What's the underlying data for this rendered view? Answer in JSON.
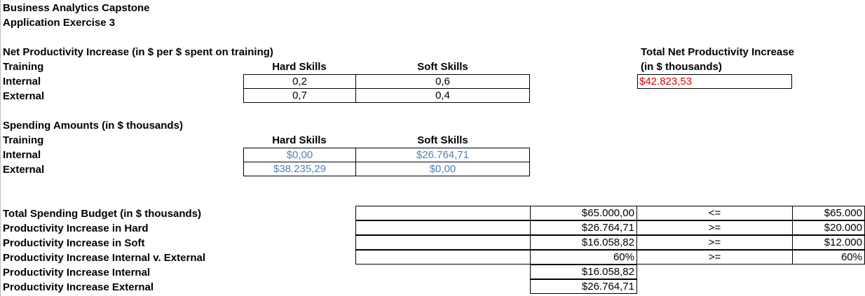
{
  "title": "Business Analytics Capstone",
  "subtitle": "Application Exercise 3",
  "net_productivity": {
    "heading": "Net Productivity Increase (in $ per $ spent on training)",
    "row_header": "Training",
    "col_hard": "Hard Skills",
    "col_soft": "Soft Skills",
    "rows": [
      {
        "label": "Internal",
        "hard": "0,2",
        "soft": "0,6"
      },
      {
        "label": "External",
        "hard": "0,7",
        "soft": "0,4"
      }
    ]
  },
  "total_net": {
    "heading1": "Total Net Productivity Increase",
    "heading2": "(in $ thousands)",
    "value": "$42.823,53",
    "value_color": "#e00000"
  },
  "spending": {
    "heading": "Spending Amounts (in $ thousands)",
    "row_header": "Training",
    "col_hard": "Hard Skills",
    "col_soft": "Soft Skills",
    "value_color": "#4f81bd",
    "rows": [
      {
        "label": "Internal",
        "hard": "$0,00",
        "soft": "$26.764,71"
      },
      {
        "label": "External",
        "hard": "$38.235,29",
        "soft": "$0,00"
      }
    ]
  },
  "constraints": [
    {
      "label": "Total Spending Budget (in $ thousands)",
      "value": "$65.000,00",
      "op": "<=",
      "limit": "$65.000"
    },
    {
      "label": "Productivity Increase in Hard",
      "value": "$26.764,71",
      "op": ">=",
      "limit": "$20.000"
    },
    {
      "label": "Productivity Increase in Soft",
      "value": "$16.058,82",
      "op": ">=",
      "limit": "$12.000"
    },
    {
      "label": "Productivity Increase Internal v. External",
      "value": "60%",
      "op": ">=",
      "limit": "60%"
    },
    {
      "label": "Productivity Increase Internal",
      "value": "$16.058,82"
    },
    {
      "label": "Productivity Increase External",
      "value": "$26.764,71"
    }
  ]
}
